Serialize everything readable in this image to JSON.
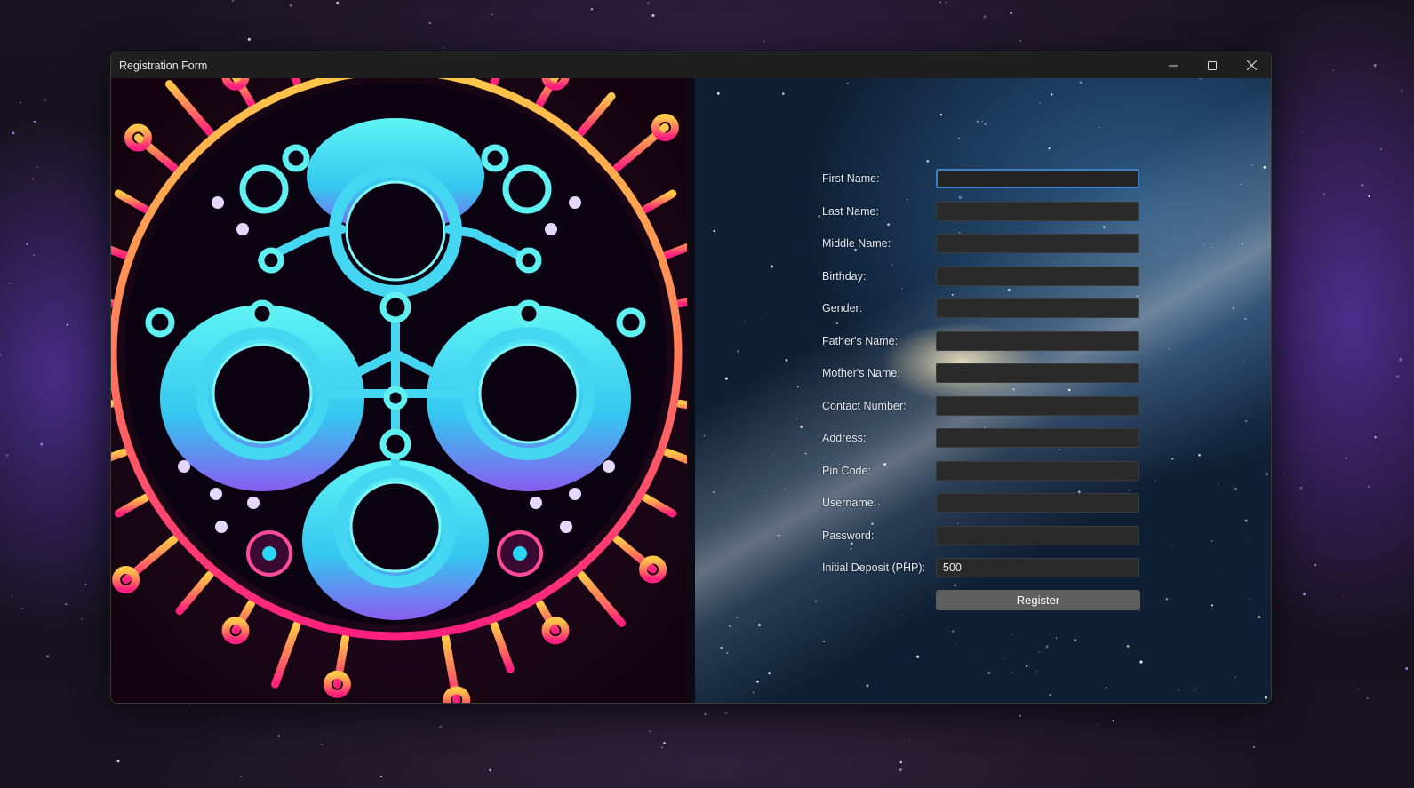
{
  "window": {
    "title": "Registration Form",
    "controls": [
      "minimize-icon",
      "maximize-icon",
      "close-icon"
    ]
  },
  "left_panel": {
    "image": "neon-circuit-emblem",
    "colors": {
      "cyan": "#3fe0f0",
      "pink": "#ff2e82",
      "orange": "#ffb04a",
      "dark": "#1a0716"
    }
  },
  "form": {
    "fields": [
      {
        "label": "First Name:",
        "value": "",
        "focused": true
      },
      {
        "label": "Last Name:",
        "value": ""
      },
      {
        "label": "Middle Name:",
        "value": ""
      },
      {
        "label": "Birthday:",
        "value": ""
      },
      {
        "label": "Gender:",
        "value": ""
      },
      {
        "label": "Father's Name:",
        "value": ""
      },
      {
        "label": "Mother's Name:",
        "value": ""
      },
      {
        "label": "Contact Number:",
        "value": ""
      },
      {
        "label": "Address:",
        "value": ""
      },
      {
        "label": "Pin Code:",
        "value": ""
      },
      {
        "label": "Username:",
        "value": ""
      },
      {
        "label": "Password:",
        "value": ""
      },
      {
        "label": "Initial Deposit (PHP):",
        "value": "500"
      }
    ],
    "register_label": "Register",
    "accent_color": "#3d7fbf"
  }
}
